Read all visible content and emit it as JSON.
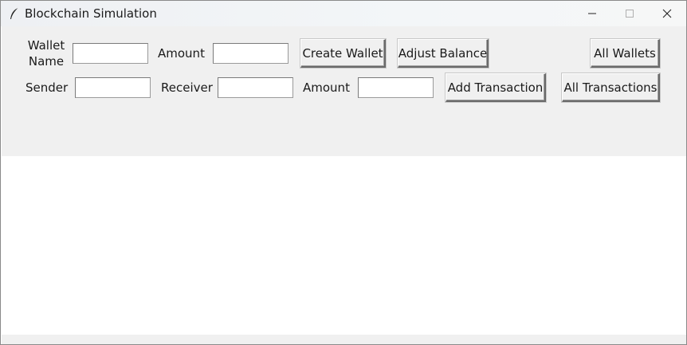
{
  "window": {
    "title": "Blockchain Simulation",
    "icons": {
      "app": "feather-icon",
      "minimize": "minimize-icon",
      "maximize": "maximize-icon",
      "close": "close-icon"
    }
  },
  "wallet_row": {
    "wallet_name_label": "Wallet Name",
    "wallet_name_value": "",
    "amount_label": "Amount",
    "amount_value": "",
    "create_wallet_button": "Create Wallet",
    "adjust_balance_button": "Adjust Balance",
    "all_wallets_button": "All Wallets"
  },
  "transaction_row": {
    "sender_label": "Sender",
    "sender_value": "",
    "receiver_label": "Receiver",
    "receiver_value": "",
    "amount_label": "Amount",
    "amount_value": "",
    "add_transaction_button": "Add Transaction",
    "all_transactions_button": "All Transactions"
  }
}
